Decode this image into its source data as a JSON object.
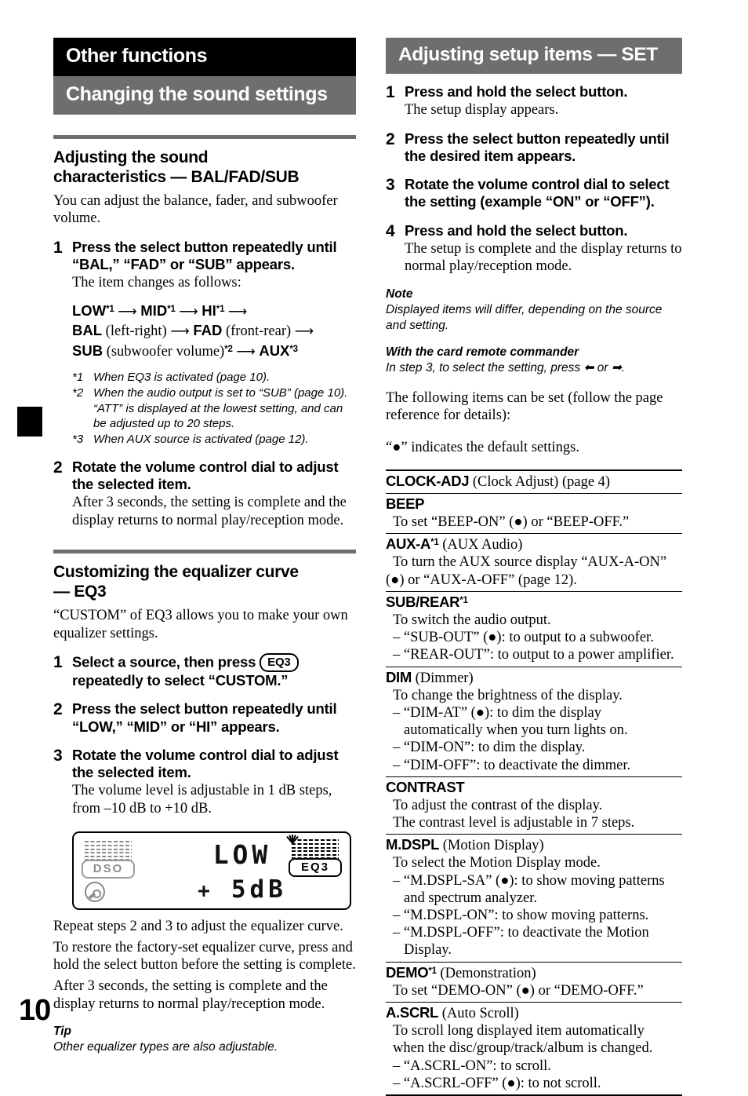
{
  "page": {
    "number": "10"
  },
  "left": {
    "banner_black": "Other functions",
    "banner_gray": "Changing the sound settings",
    "section1": {
      "heading_line1": "Adjusting the sound",
      "heading_line2": "characteristics — BAL/FAD/SUB",
      "intro": "You can adjust the balance, fader, and subwoofer volume.",
      "steps": [
        {
          "num": "1",
          "title": "Press the select button repeatedly until “BAL,” “FAD” or “SUB” appears.",
          "desc": "The item changes as follows:"
        },
        {
          "num": "2",
          "title": "Rotate the volume control dial to adjust the selected item.",
          "desc": "After 3 seconds, the setting is complete and the display returns to normal play/reception mode."
        }
      ],
      "flow": {
        "line1_a": "LOW",
        "line1_s1": "*1",
        "line1_b": "MID",
        "line1_s2": "*1",
        "line1_c": "HI",
        "line1_s3": "*1",
        "line2_a": "BAL",
        "line2_a_paren": "(left-right)",
        "line2_b": "FAD",
        "line2_b_paren": "(front-rear)",
        "line3_a": "SUB",
        "line3_a_paren": "(subwoofer volume)",
        "line3_s1": "*2",
        "line3_b": "AUX",
        "line3_s2": "*3",
        "arrow": "⟶"
      },
      "footnotes": [
        {
          "mark": "*1",
          "text": "When EQ3 is activated (page 10)."
        },
        {
          "mark": "*2",
          "text": "When the audio output is set to “SUB” (page 10).",
          "extra": "“ATT” is displayed at the lowest setting, and can be adjusted up to 20 steps."
        },
        {
          "mark": "*3",
          "text": "When AUX source is activated (page 12)."
        }
      ]
    },
    "section2": {
      "heading_line1": "Customizing the equalizer curve",
      "heading_line2": "— EQ3",
      "intro": "“CUSTOM” of EQ3 allows you to make your own equalizer settings.",
      "steps": [
        {
          "num": "1",
          "title_before": "Select a source, then press",
          "button_label": "EQ3",
          "title_after": "repeatedly to select “CUSTOM.”"
        },
        {
          "num": "2",
          "title": "Press the select button repeatedly until “LOW,” “MID” or “HI” appears."
        },
        {
          "num": "3",
          "title": "Rotate the volume control dial to adjust the selected item.",
          "desc": "The volume level is adjustable in 1 dB steps, from –10 dB to +10 dB."
        }
      ],
      "lcd": {
        "left_tag": "DSO",
        "right_tag": "EQ3",
        "main_text": "LOW",
        "sub_plus": "+",
        "sub_value": "5dB"
      },
      "after_figure": [
        "Repeat steps 2 and 3 to adjust the equalizer curve.",
        "To restore the factory-set equalizer curve, press and hold the select button before the setting is complete.",
        "After 3 seconds, the setting is complete and the display returns to normal play/reception mode."
      ],
      "tip_head": "Tip",
      "tip_body": "Other equalizer types are also adjustable."
    }
  },
  "right": {
    "banner_gray": "Adjusting setup items — SET",
    "steps": [
      {
        "num": "1",
        "title": "Press and hold the select button.",
        "desc": "The setup display appears."
      },
      {
        "num": "2",
        "title": "Press the select button repeatedly until the desired item appears."
      },
      {
        "num": "3",
        "title": "Rotate the volume control dial to select the setting (example “ON” or “OFF”)."
      },
      {
        "num": "4",
        "title": "Press and hold the select button.",
        "desc": "The setup is complete and the display returns to normal play/reception mode."
      }
    ],
    "note_head": "Note",
    "note_body": "Displayed items will differ, depending on the source and setting.",
    "remote_head": "With the card remote commander",
    "remote_body_before": "In step 3, to select the setting, press",
    "remote_arrow_left": "⬅",
    "remote_or": "or",
    "remote_arrow_right": "➡",
    "remote_body_after": ".",
    "intro_line1": "The following items can be set (follow the page reference for details):",
    "intro_line2": "“●” indicates the default settings.",
    "settings": [
      {
        "name_bold": "CLOCK-ADJ",
        "name_rest": " (Clock Adjust) (page 4)",
        "lines": []
      },
      {
        "name_bold": "BEEP",
        "name_rest": "",
        "lines": [
          "To set “BEEP-ON” (●) or “BEEP-OFF.”"
        ]
      },
      {
        "name_bold": "AUX-A",
        "name_sup": "*1",
        "name_rest": " (AUX Audio)",
        "lines": [
          "To turn the AUX source display “AUX-A-ON”",
          "(●) or “AUX-A-OFF” (page 12)."
        ],
        "lines_flush": [
          false,
          true
        ]
      },
      {
        "name_bold": "SUB/REAR",
        "name_sup": "*1",
        "name_rest": "",
        "lines": [
          "To switch the audio output.",
          "– “SUB-OUT” (●): to output to a subwoofer.",
          "– “REAR-OUT”: to output to a power amplifier."
        ]
      },
      {
        "name_bold": "DIM",
        "name_rest": " (Dimmer)",
        "lines": [
          "To change the brightness of the display.",
          "– “DIM-AT” (●): to dim the display",
          "automatically when you turn lights on.",
          "– “DIM-ON”: to dim the display.",
          "– “DIM-OFF”: to deactivate the dimmer."
        ],
        "indent": [
          false,
          false,
          true,
          false,
          false
        ]
      },
      {
        "name_bold": "CONTRAST",
        "name_rest": "",
        "lines": [
          "To adjust the contrast of the display.",
          "The contrast level is adjustable in 7 steps."
        ]
      },
      {
        "name_bold": "M.DSPL",
        "name_rest": " (Motion Display)",
        "lines": [
          "To select the Motion Display mode.",
          "– “M.DSPL-SA” (●): to show moving patterns",
          "and spectrum analyzer.",
          "– “M.DSPL-ON”: to show moving patterns.",
          "– “M.DSPL-OFF”: to deactivate the Motion",
          "Display."
        ],
        "indent": [
          false,
          false,
          true,
          false,
          false,
          true
        ]
      },
      {
        "name_bold": "DEMO",
        "name_sup": "*1",
        "name_rest": " (Demonstration)",
        "lines": [
          "To set “DEMO-ON” (●) or “DEMO-OFF.”"
        ]
      },
      {
        "name_bold": "A.SCRL",
        "name_rest": " (Auto Scroll)",
        "lines": [
          "To scroll long displayed item automatically",
          "when the disc/group/track/album is changed.",
          "– “A.SCRL-ON”: to scroll.",
          "– “A.SCRL-OFF” (●): to not scroll."
        ]
      }
    ]
  }
}
